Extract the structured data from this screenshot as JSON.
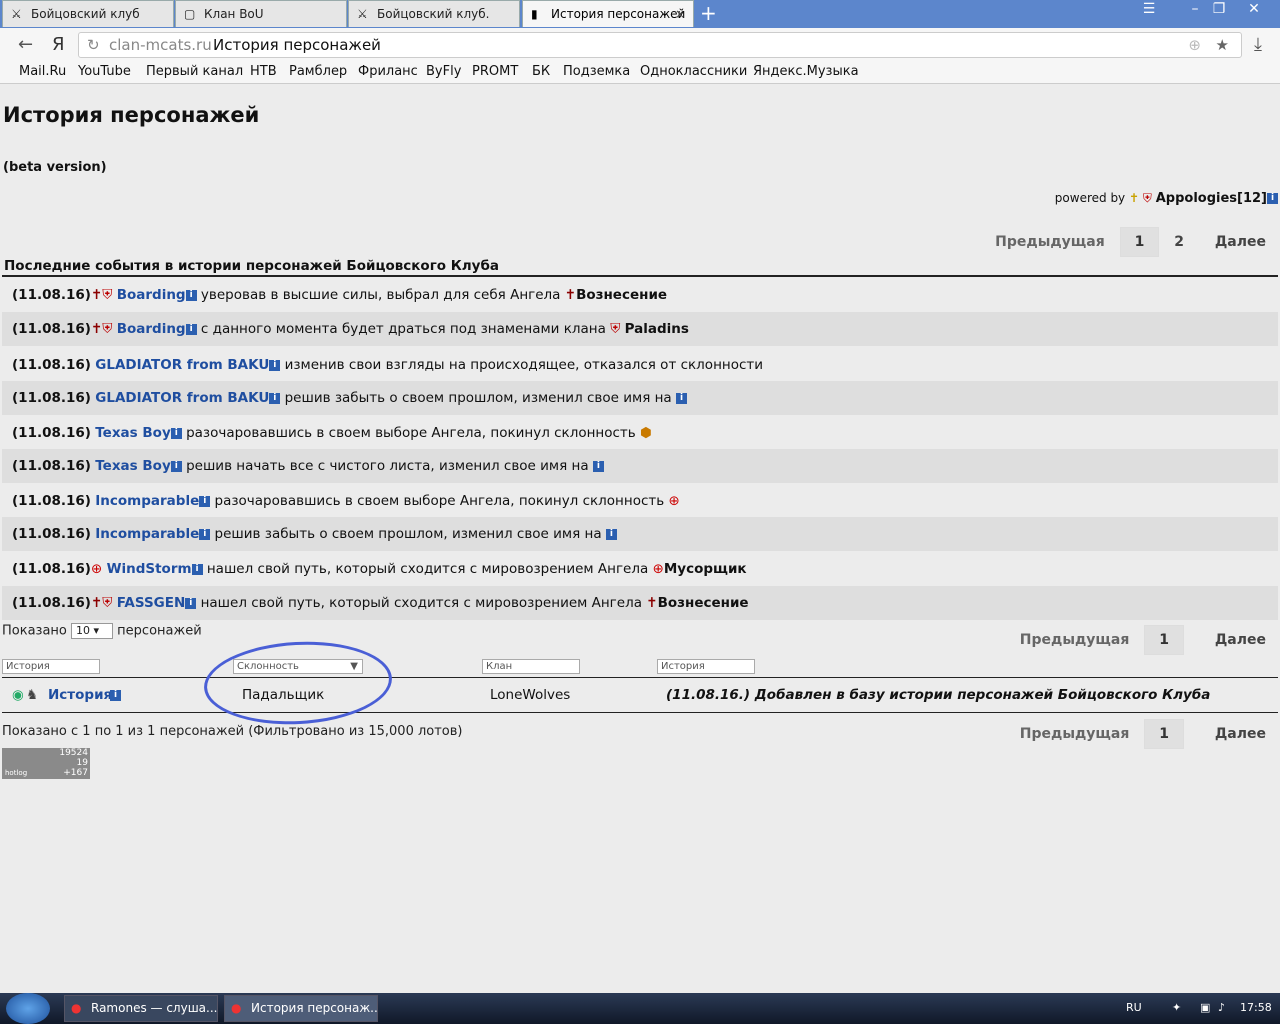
{
  "browser": {
    "tabs": [
      {
        "label": "Бойцовский клуб",
        "icon": "swords-icon"
      },
      {
        "label": "Клан BoU",
        "icon": "page-icon"
      },
      {
        "label": "Бойцовский клуб.",
        "icon": "swords-icon"
      },
      {
        "label": "История персонажей",
        "icon": "page-icon",
        "close": "×"
      }
    ],
    "new_tab": "+",
    "host": "clan-mcats.ru",
    "page_title": "История персонажей",
    "yandex_btn": "Я",
    "bookmarks": [
      "Mail.Ru",
      "YouTube",
      "Первый канал",
      "НТВ",
      "Рамблер",
      "Фриланс",
      "ByFly",
      "PROMT",
      "БК",
      "Подземка",
      "Одноклассники",
      "Яндекс.Музыка"
    ]
  },
  "page": {
    "title": "История персонажей",
    "beta": "(beta version)",
    "powered_by": "powered by",
    "author": "Appologies[12]",
    "pager_top": {
      "prev": "Предыдущая",
      "p1": "1",
      "p2": "2",
      "next": "Далее"
    },
    "section": "Последние события в истории персонажей Бойцовского Клуба",
    "events": [
      {
        "date": "(11.08.16)",
        "nick": "Boarding",
        "text": "уверовав в высшие силы, выбрал для себя Ангела",
        "target": "Вознесение"
      },
      {
        "date": "(11.08.16)",
        "nick": "Boarding",
        "text": "с данного момента будет драться под знаменами клана",
        "target": "Paladins"
      },
      {
        "date": "(11.08.16)",
        "nick": "GLADIATOR from BAKU",
        "text": "изменив свои взгляды на происходящее, отказался от склонности",
        "target": ""
      },
      {
        "date": "(11.08.16)",
        "nick": "GLADIATOR from BAKU",
        "text": "решив забыть о своем прошлом, изменил свое имя на",
        "target": ""
      },
      {
        "date": "(11.08.16)",
        "nick": "Texas Boy",
        "text": "разочаровавшись в своем выборе Ангела, покинул склонность",
        "target": ""
      },
      {
        "date": "(11.08.16)",
        "nick": "Texas Boy",
        "text": "решив начать все с чистого листа, изменил свое имя на",
        "target": ""
      },
      {
        "date": "(11.08.16)",
        "nick": "Incomparable",
        "text": "разочаровавшись в своем выборе Ангела, покинул склонность",
        "target": ""
      },
      {
        "date": "(11.08.16)",
        "nick": "Incomparable",
        "text": "решив забыть о своем прошлом, изменил свое имя на",
        "target": ""
      },
      {
        "date": "(11.08.16)",
        "nick": "WindStorm",
        "text": "нашел свой путь, который сходится с мировозрением Ангела",
        "target": "Мусорщик"
      },
      {
        "date": "(11.08.16)",
        "nick": "FASSGEN",
        "text": "нашел свой путь, который сходится с мировозрением Ангела",
        "target": "Вознесение"
      }
    ],
    "shown_prefix": "Показано",
    "shown_count": "10",
    "shown_suffix": "персонажей",
    "pager_mid": {
      "prev": "Предыдущая",
      "p1": "1",
      "next": "Далее"
    },
    "filters": {
      "history": "История",
      "alignment": "Склонность",
      "clan": "Клан",
      "history2": "История"
    },
    "result": {
      "nick": "История",
      "alignment": "Падальщик",
      "clan": "LoneWolves",
      "event": "(11.08.16.) Добавлен в базу истории персонажей Бойцовского Клуба"
    },
    "shown_total": "Показано с 1 по 1 из 1 персонажей (Фильтровано из 15,000 лотов)",
    "pager_bottom": {
      "prev": "Предыдущая",
      "p1": "1",
      "next": "Далее"
    },
    "counter": {
      "a": "19524",
      "b": "19",
      "c": "+167",
      "brand": "hotlog"
    }
  },
  "taskbar": {
    "items": [
      "Ramones — слуша...",
      "История персонаж..."
    ],
    "lang": "RU",
    "time": "17:58"
  }
}
